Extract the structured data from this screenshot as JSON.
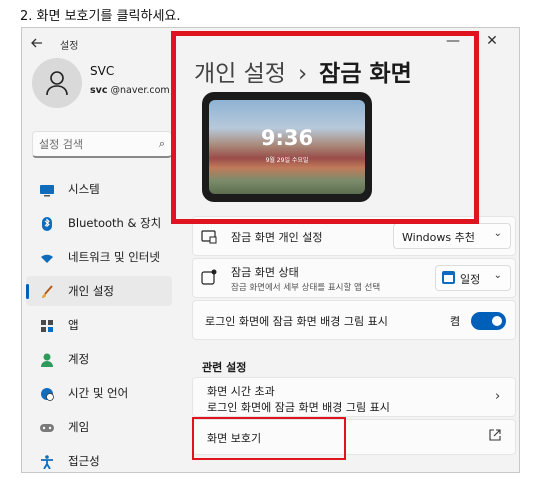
{
  "instruction": "2. 화면 보호기를 클릭하세요.",
  "window": {
    "app_title": "설정",
    "back_icon": "back-arrow-icon",
    "minimize_glyph": "—",
    "close_glyph": "✕"
  },
  "profile": {
    "name": "SVC",
    "email_prefix": "svc",
    "email_domain": "@naver.com"
  },
  "search": {
    "placeholder": "설정 검색",
    "icon": "search-icon"
  },
  "nav": {
    "items": [
      {
        "label": "시스템",
        "icon": "monitor-icon",
        "active": false
      },
      {
        "label": "Bluetooth & 장치",
        "icon": "bluetooth-icon",
        "active": false
      },
      {
        "label": "네트워크 및 인터넷",
        "icon": "wifi-icon",
        "active": false
      },
      {
        "label": "개인 설정",
        "icon": "brush-icon",
        "active": true
      },
      {
        "label": "앱",
        "icon": "apps-icon",
        "active": false
      },
      {
        "label": "계정",
        "icon": "person-icon",
        "active": false
      },
      {
        "label": "시간 및 언어",
        "icon": "globe-clock-icon",
        "active": false
      },
      {
        "label": "게임",
        "icon": "gamepad-icon",
        "active": false
      },
      {
        "label": "접근성",
        "icon": "accessibility-icon",
        "active": false
      }
    ]
  },
  "main": {
    "breadcrumb_parent": "개인 설정",
    "breadcrumb_separator": "›",
    "breadcrumb_current": "잠금 화면",
    "preview": {
      "time": "9:36",
      "date": "9월 29일 수요일"
    },
    "personalize_row": {
      "title": "잠금 화면 개인 설정",
      "dropdown_value": "Windows 추천"
    },
    "status_row": {
      "title": "잠금 화면 상태",
      "subtitle": "잠금 화면에서 세부 상태를 표시할 앱 선택",
      "dropdown_value": "일정"
    },
    "background_row": {
      "title": "로그인 화면에 잠금 화면 배경 그림 표시",
      "toggle_label": "켬",
      "toggle_on": true
    },
    "related_heading": "관련 설정",
    "timeout_row": {
      "title": "화면 시간 초과",
      "subtitle": "로그인 화면에 잠금 화면 배경 그림 표시"
    },
    "screensaver_row": {
      "title": "화면 보호기"
    }
  },
  "colors": {
    "highlight": "#e0141e",
    "accent": "#005fb8"
  }
}
